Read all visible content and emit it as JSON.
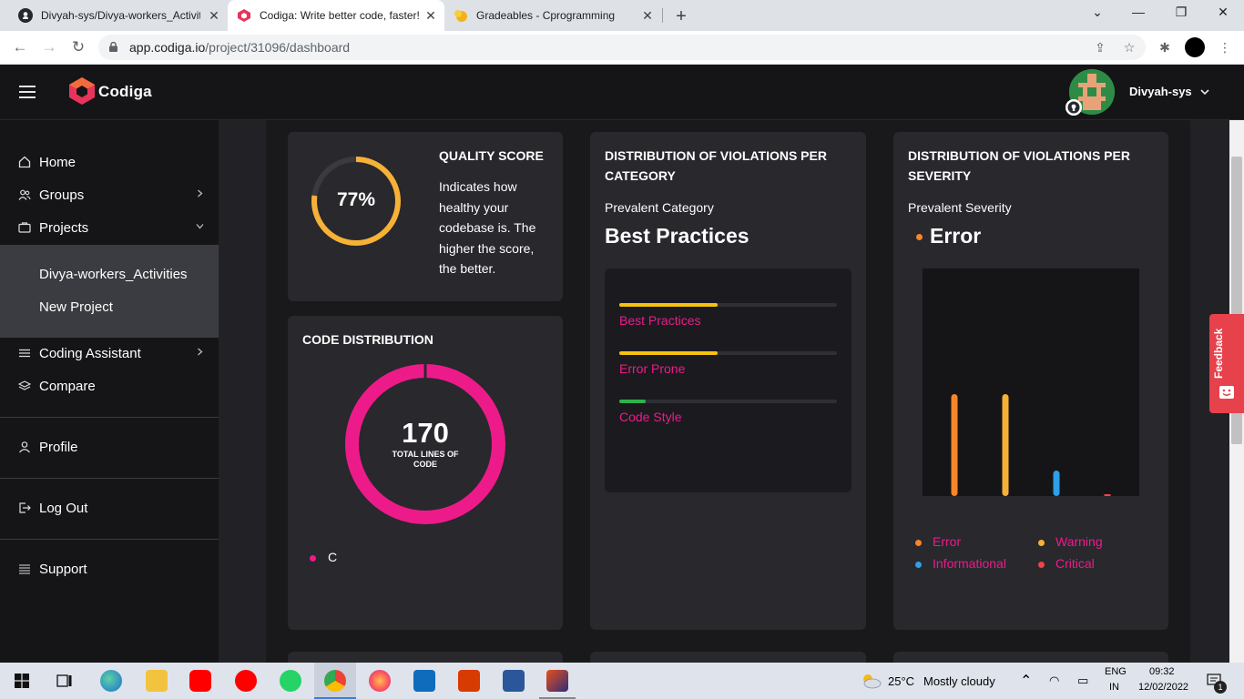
{
  "browser": {
    "tabs": [
      {
        "title": "Divyah-sys/Divya-workers_Activit",
        "active": false
      },
      {
        "title": "Codiga: Write better code, faster!",
        "active": true
      },
      {
        "title": "Gradeables - Cprogramming",
        "active": false
      }
    ],
    "url_host": "app.codiga.io",
    "url_path": "/project/31096/dashboard"
  },
  "app": {
    "logo_text": "Codiga",
    "username": "Divyah-sys",
    "accent": "#ed1b8a"
  },
  "sidebar": {
    "items": [
      {
        "label": "Home",
        "icon": "home-icon"
      },
      {
        "label": "Groups",
        "icon": "groups-icon"
      },
      {
        "label": "Projects",
        "icon": "projects-icon"
      },
      {
        "label": "Coding Assistant",
        "icon": "list-icon"
      },
      {
        "label": "Compare",
        "icon": "layers-icon"
      },
      {
        "label": "Profile",
        "icon": "user-icon"
      },
      {
        "label": "Log Out",
        "icon": "logout-icon"
      },
      {
        "label": "Support",
        "icon": "menu-icon"
      }
    ],
    "projects": [
      "Divya-workers_Activities",
      "New Project"
    ]
  },
  "quality": {
    "title": "QUALITY SCORE",
    "score_text": "77%",
    "score": 0.77,
    "description": "Indicates how healthy your codebase is. The higher the score, the better."
  },
  "code_distribution": {
    "title": "CODE DISTRIBUTION",
    "total": "170",
    "total_label": "TOTAL LINES OF CODE",
    "legend": [
      {
        "label": "C",
        "color": "#ed1b8a"
      }
    ]
  },
  "category": {
    "title": "DISTRIBUTION OF VIOLATIONS PER CATEGORY",
    "prevalent_label": "Prevalent Category",
    "prevalent_value": "Best Practices",
    "bars": [
      {
        "label": "Best Practices",
        "fraction": 0.45,
        "color": "#f6c20f"
      },
      {
        "label": "Error Prone",
        "fraction": 0.45,
        "color": "#f6c20f"
      },
      {
        "label": "Code Style",
        "fraction": 0.12,
        "color": "#2fb24c"
      }
    ]
  },
  "severity": {
    "title": "DISTRIBUTION OF VIOLATIONS PER SEVERITY",
    "prevalent_label": "Prevalent Severity",
    "prevalent_value": "Error",
    "prevalent_color": "#f7852a",
    "chart_data": {
      "type": "bar",
      "categories": [
        "Error",
        "Warning",
        "Informational",
        "Critical"
      ],
      "values": [
        1.0,
        1.0,
        0.25,
        0.0
      ],
      "colors": [
        "#f7852a",
        "#f6b236",
        "#2f9fe7",
        "#ee4444"
      ]
    },
    "legend": [
      {
        "label": "Error",
        "color": "#f7852a"
      },
      {
        "label": "Warning",
        "color": "#f6b236"
      },
      {
        "label": "Informational",
        "color": "#2f9fe7"
      },
      {
        "label": "Critical",
        "color": "#ee4444"
      }
    ]
  },
  "feedback_label": "Feedback",
  "taskbar": {
    "temp": "25°C",
    "weather": "Mostly cloudy",
    "lang1": "ENG",
    "lang2": "IN",
    "time": "09:32",
    "date": "12/02/2022",
    "notif_count": "1"
  }
}
